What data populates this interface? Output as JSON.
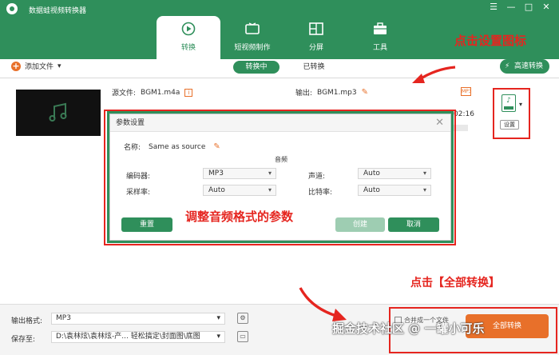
{
  "app": {
    "title": "数据蛙视频转换器"
  },
  "window_buttons": [
    "☰",
    "—",
    "□",
    "✕"
  ],
  "tabs": [
    {
      "label": "转换",
      "icon": "convert-icon",
      "active": true
    },
    {
      "label": "短视频制作",
      "icon": "tv-icon",
      "active": false
    },
    {
      "label": "分屏",
      "icon": "split-screen-icon",
      "active": false
    },
    {
      "label": "工具",
      "icon": "toolbox-icon",
      "active": false
    }
  ],
  "toolbar": {
    "add_file": "添加文件",
    "add_file_arrow": "▾",
    "seg_converting": "转换中",
    "seg_converted": "已转换",
    "speed": "高速转换"
  },
  "file": {
    "source_label": "源文件:",
    "source_name": "BGM1.m4a",
    "output_label": "输出:",
    "output_name": "BGM1.mp3",
    "format_badge": "MP3",
    "duration": "02:16",
    "setting_arrow": "▾",
    "setting_btn": "设置"
  },
  "dialog": {
    "title": "参数设置",
    "close": "✕",
    "name_label": "名称:",
    "name_value": "Same as source",
    "section": "音频",
    "encoder_label": "编码器:",
    "encoder_value": "MP3",
    "channel_label": "声道:",
    "channel_value": "Auto",
    "samplerate_label": "采样率:",
    "samplerate_value": "Auto",
    "bitrate_label": "比特率:",
    "bitrate_value": "Auto",
    "reset": "重置",
    "create": "创建",
    "cancel": "取消"
  },
  "bottom": {
    "format_label": "输出格式:",
    "format_value": "MP3",
    "save_label": "保存至:",
    "save_value": "D:\\袁林炫\\袁林炫-产... 轻松搞定\\封面图\\底图",
    "merge": "合并成一个文件",
    "convert_all": "全部转换"
  },
  "annotations": {
    "settings_hint": "点击设置图标",
    "adjust_hint": "调整音频格式的参数",
    "convert_hint": "点击【全部转换】"
  },
  "watermark": "掘金技术社区 @ 一罐小可乐",
  "colors": {
    "brand_green": "#2f8f5b",
    "accent_orange": "#e8702a",
    "annotation_red": "#e5251f"
  }
}
